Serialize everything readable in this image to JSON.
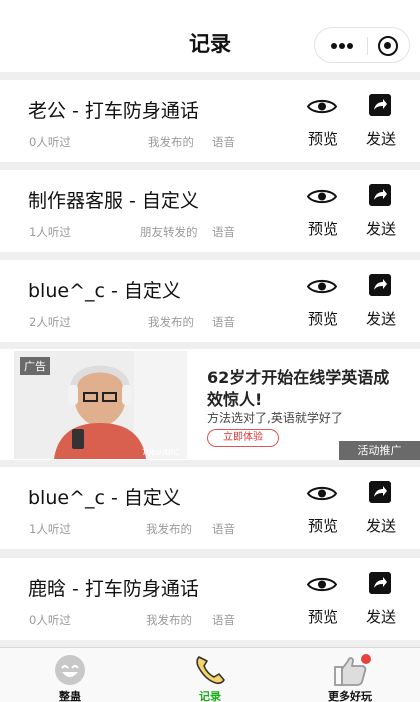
{
  "header": {
    "title": "记录"
  },
  "records": [
    {
      "title": "老公 - 打车防身通话",
      "listeners": "0人听过",
      "source": "我发布的",
      "type": "语音",
      "preview": "预览",
      "send": "发送"
    },
    {
      "title": "制作器客服 - 自定义",
      "listeners": "1人听过",
      "source": "朋友转发的",
      "type": "语音",
      "preview": "预览",
      "send": "发送"
    },
    {
      "title": "blue^_c - 自定义",
      "listeners": "2人听过",
      "source": "我发布的",
      "type": "语音",
      "preview": "预览",
      "send": "发送"
    },
    {
      "title": "blue^_c - 自定义",
      "listeners": "1人听过",
      "source": "我发布的",
      "type": "语音",
      "preview": "预览",
      "send": "发送"
    },
    {
      "title": "鹿晗 - 打车防身通话",
      "listeners": "0人听过",
      "source": "我发布的",
      "type": "语音",
      "preview": "预览",
      "send": "发送"
    }
  ],
  "ad": {
    "tag": "广告",
    "headline": "62岁才开始在线学英语成效惊人!",
    "subtext": "方法选对了,英语就学好了",
    "cta": "立即体验",
    "promo": "活动推广",
    "brand": "TutorABC"
  },
  "tabbar": {
    "items": [
      {
        "label": "整蛊",
        "icon": "smiley-icon"
      },
      {
        "label": "记录",
        "icon": "phone-icon",
        "active": true
      },
      {
        "label": "更多好玩",
        "icon": "thumbs-up-icon",
        "badge": true
      }
    ]
  },
  "colors": {
    "active_tab": "#1aad19",
    "badge": "#e64340"
  }
}
